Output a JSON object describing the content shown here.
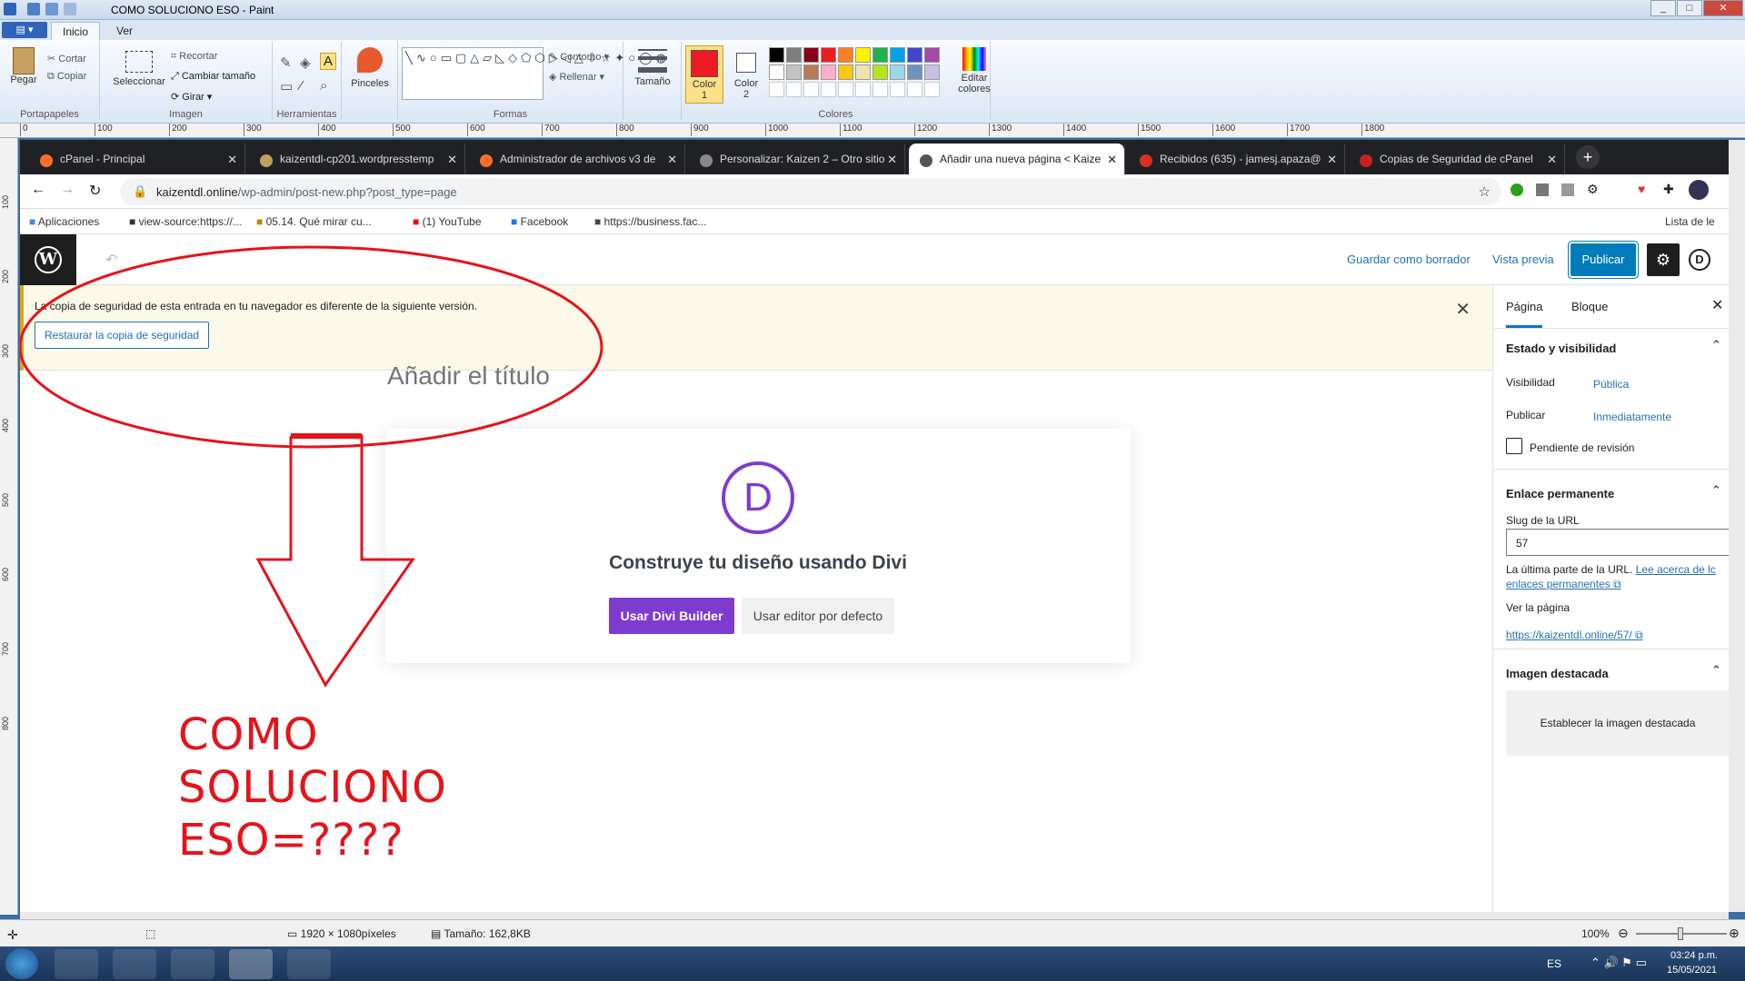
{
  "paint": {
    "title": "COMO SOLUCIONO ESO - Paint",
    "tabs": [
      "Inicio",
      "Ver"
    ],
    "ribbon": {
      "pegar": "Pegar",
      "cortar": "Cortar",
      "copiar": "Copiar",
      "portapapeles": "Portapapeles",
      "seleccionar": "Seleccionar",
      "recortar": "Recortar",
      "cambiar_tamano": "Cambiar tamaño",
      "girar": "Girar",
      "imagen": "Imagen",
      "herramientas": "Herramientas",
      "pinceles": "Pinceles",
      "contorno": "Contorno",
      "rellenar": "Rellenar",
      "formas": "Formas",
      "tamano": "Tamaño",
      "color1": "Color 1",
      "color2": "Color 2",
      "colores": "Colores",
      "editar_colores": "Editar colores"
    },
    "ruler_h": [
      "0",
      "100",
      "200",
      "300",
      "400",
      "500",
      "600",
      "700",
      "800",
      "900",
      "1000",
      "1100",
      "1200",
      "1300",
      "1400",
      "1500",
      "1600",
      "1700",
      "1800"
    ],
    "ruler_v": [
      "100",
      "200",
      "300",
      "400",
      "500",
      "600",
      "700",
      "800"
    ],
    "status": {
      "dimensions": "1920 × 1080píxeles",
      "size": "Tamaño: 162,8KB",
      "zoom": "100%"
    },
    "palette": [
      "#000000",
      "#7f7f7f",
      "#880015",
      "#ed1c24",
      "#ff7f27",
      "#fff200",
      "#22b14c",
      "#00a2e8",
      "#3f48cc",
      "#a349a4",
      "#ffffff",
      "#c3c3c3",
      "#b97a57",
      "#ffaec9",
      "#ffc90e",
      "#efe4b0",
      "#b5e61d",
      "#99d9ea",
      "#7092be",
      "#c8bfe7"
    ],
    "color1": "#ed1c24",
    "color2": "#ffffff"
  },
  "browser": {
    "tabs": [
      {
        "label": "cPanel - Principal",
        "color": "#ff6c2c"
      },
      {
        "label": "kaizentdl-cp201.wordpresstemp",
        "color": "#c0a060"
      },
      {
        "label": "Administrador de archivos v3 de",
        "color": "#ff6c2c"
      },
      {
        "label": "Personalizar: Kaizen 2 – Otro sitio",
        "color": "#888888"
      },
      {
        "label": "Añadir una nueva página < Kaize",
        "color": "#555555"
      },
      {
        "label": "Recibidos (635) - jamesj.apaza@",
        "color": "#d93025"
      },
      {
        "label": "Copias de Seguridad de cPanel",
        "color": "#c5221f"
      }
    ],
    "url_host": "kaizentdl.online",
    "url_path": "/wp-admin/post-new.php?post_type=page",
    "bookmarks": [
      "Aplicaciones",
      "view-source:https://...",
      "05.14. Qué mirar cu...",
      "(1) YouTube",
      "Facebook",
      "https://business.fac..."
    ],
    "reading_list": "Lista de le"
  },
  "wp": {
    "save_draft": "Guardar como borrador",
    "preview": "Vista previa",
    "publish": "Publicar",
    "notice_text": "La copia de seguridad de esta entrada en tu navegador es diferente de la siguiente versión.",
    "restore_button": "Restaurar la copia de seguridad",
    "title_placeholder": "Añadir el título",
    "divi_heading": "Construye tu diseño usando Divi",
    "divi_button": "Usar Divi Builder",
    "default_editor": "Usar editor por defecto",
    "sidebar": {
      "tab_page": "Página",
      "tab_block": "Bloque",
      "status_title": "Estado y visibilidad",
      "visibility_label": "Visibilidad",
      "visibility_value": "Pública",
      "publish_label": "Publicar",
      "publish_value": "Inmediatamente",
      "pending_review": "Pendiente de revisión",
      "permalink_title": "Enlace permanente",
      "slug_label": "Slug de la URL",
      "slug_value": "57",
      "slug_help": "La última parte de la URL.",
      "slug_help_link": "Lee acerca de lc",
      "slug_help_link2": "enlaces permanentes",
      "view_page": "Ver la página",
      "page_link": "https://kaizentdl.online/57/",
      "featured_title": "Imagen destacada",
      "featured_button": "Establecer la imagen destacada"
    }
  },
  "annotation": {
    "line1": "COMO",
    "line2": "SOLUCIONO",
    "line3": "ESO=????"
  },
  "taskbar": {
    "lang": "ES",
    "time": "03:24 p.m.",
    "date": "15/05/2021"
  }
}
